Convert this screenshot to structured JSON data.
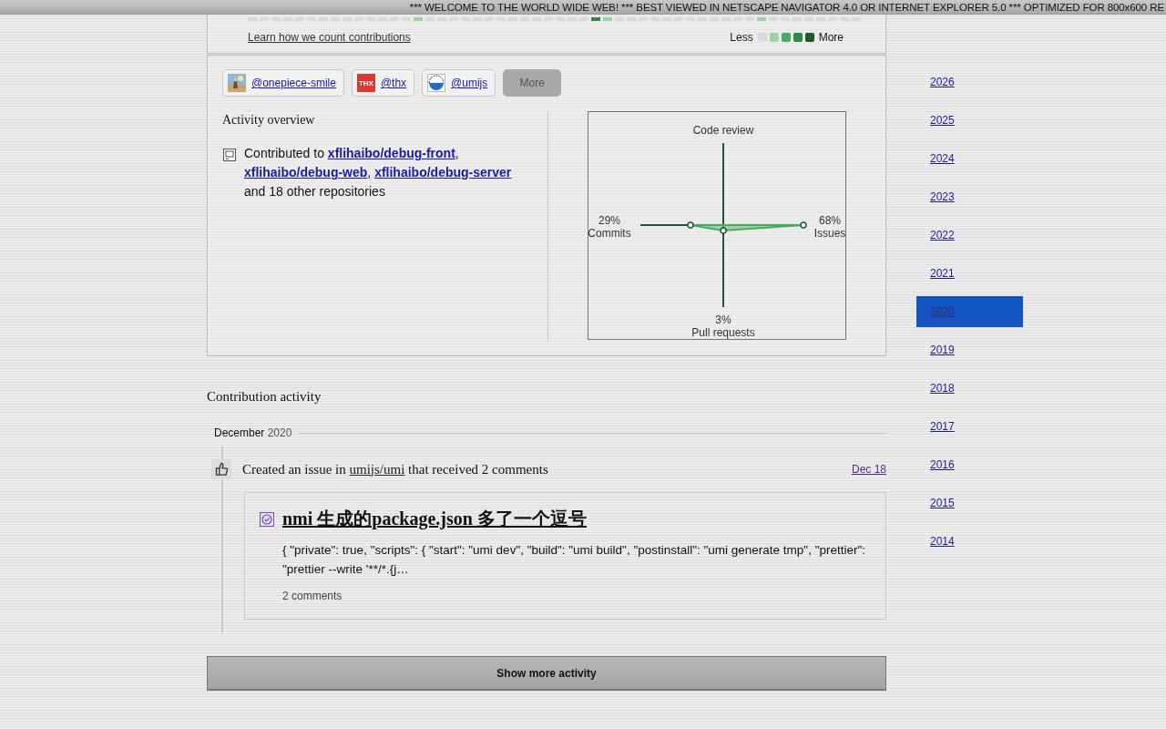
{
  "marquee": "*** WELCOME TO THE WORLD WIDE WEB! *** BEST VIEWED IN NETSCAPE NAVIGATOR 4.0 OR INTERNET EXPLORER 5.0 *** OPTIMIZED FOR 800x600 RE",
  "contribution_graph": {
    "cells": [
      {
        "color": "#dadada"
      },
      {
        "color": "#dadada"
      },
      {
        "color": "#dadada"
      },
      {
        "color": "#dadada"
      },
      {
        "color": "#dadada"
      },
      {
        "color": "#dadada"
      },
      {
        "color": "#dadada"
      },
      {
        "color": "#dadada"
      },
      {
        "color": "#dadada"
      },
      {
        "color": "#dadada"
      },
      {
        "color": "#dadada"
      },
      {
        "color": "#dadada"
      },
      {
        "color": "#dadada"
      },
      {
        "color": "#dadada"
      },
      {
        "color": "#9bd3a6"
      },
      {
        "color": "#dadada"
      },
      {
        "color": "#dadada"
      },
      {
        "color": "#dadada"
      },
      {
        "color": "#dadada"
      },
      {
        "color": "#dadada"
      },
      {
        "color": "#dadada"
      },
      {
        "color": "#dadada"
      },
      {
        "color": "#dadada"
      },
      {
        "color": "#dadada"
      },
      {
        "color": "#dadada"
      },
      {
        "color": "#dadada"
      },
      {
        "color": "#dadada"
      },
      {
        "color": "#dadada"
      },
      {
        "color": "#dadada"
      },
      {
        "color": "#2e8b46"
      },
      {
        "color": "#9bd3a6"
      },
      {
        "color": "#dadada"
      },
      {
        "color": "#dadada"
      },
      {
        "color": "#dadada"
      },
      {
        "color": "#dadada"
      },
      {
        "color": "#dadada"
      },
      {
        "color": "#dadada"
      },
      {
        "color": "#dadada"
      },
      {
        "color": "#dadada"
      },
      {
        "color": "#dadada"
      },
      {
        "color": "#dadada"
      },
      {
        "color": "#dadada"
      },
      {
        "color": "#dadada"
      },
      {
        "color": "#9bd3a6"
      },
      {
        "color": "#dadada"
      },
      {
        "color": "#dadada"
      },
      {
        "color": "#dadada"
      },
      {
        "color": "#dadada"
      },
      {
        "color": "#dadada"
      },
      {
        "color": "#dadada"
      },
      {
        "color": "#dadada"
      },
      {
        "color": "#dadada"
      }
    ],
    "learn_link": "Learn how we count contributions",
    "legend": {
      "less": "Less",
      "more": "More",
      "swatches": [
        {
          "color": "#dadada"
        },
        {
          "color": "#9bd3a6"
        },
        {
          "color": "#4bab62"
        },
        {
          "color": "#2e8b46"
        },
        {
          "color": "#1d5a2e"
        }
      ]
    }
  },
  "organizations": [
    {
      "handle": "@onepiece-smile"
    },
    {
      "handle": "@thx",
      "avatar": {
        "kind": "text",
        "text": "THX"
      }
    },
    {
      "handle": "@umijs",
      "avatar": {
        "kind": "logo"
      }
    }
  ],
  "more_button": "More",
  "activity_overview": {
    "title": "Activity overview",
    "prefix": "Contributed to",
    "repos": [
      {
        "name": "xflihaibo/debug-front",
        "after": ","
      },
      {
        "name": "xflihaibo/debug-web",
        "after": ","
      },
      {
        "name": "xflihaibo/debug-server"
      }
    ],
    "suffix": "and 18 other repositories"
  },
  "radar": {
    "axes": [
      {
        "label": "Code review"
      },
      {
        "label": "Commits",
        "pct": "29%"
      },
      {
        "label": "Issues",
        "pct": "68%"
      },
      {
        "label": "Pull requests",
        "pct": "3%"
      }
    ]
  },
  "contribution_activity": {
    "title": "Contribution activity",
    "month": "December",
    "year": "2020",
    "events": [
      {
        "kind": "issue",
        "before": "Created an issue in",
        "repo": "umijs/umi",
        "after": "that received 2 comments",
        "date": "Dec 18",
        "issue": {
          "title": "nmi 生成的package.json 多了一个逗号",
          "body": "{ \"private\": true, \"scripts\": { \"start\": \"umi dev\", \"build\": \"umi build\", \"postinstall\": \"umi generate tmp\", \"prettier\": \"prettier --write '**/*.{j…",
          "comments": "2 comments"
        }
      }
    ]
  },
  "show_more": "Show more activity",
  "years": [
    {
      "label": "2026",
      "selected": false
    },
    {
      "label": "2025",
      "selected": false
    },
    {
      "label": "2024",
      "selected": false
    },
    {
      "label": "2023",
      "selected": false
    },
    {
      "label": "2022",
      "selected": false
    },
    {
      "label": "2021",
      "selected": false
    },
    {
      "label": "2020",
      "selected": true
    },
    {
      "label": "2019",
      "selected": false
    },
    {
      "label": "2018",
      "selected": false
    },
    {
      "label": "2017",
      "selected": false
    },
    {
      "label": "2016",
      "selected": false
    },
    {
      "label": "2015",
      "selected": false
    },
    {
      "label": "2014",
      "selected": false
    }
  ]
}
